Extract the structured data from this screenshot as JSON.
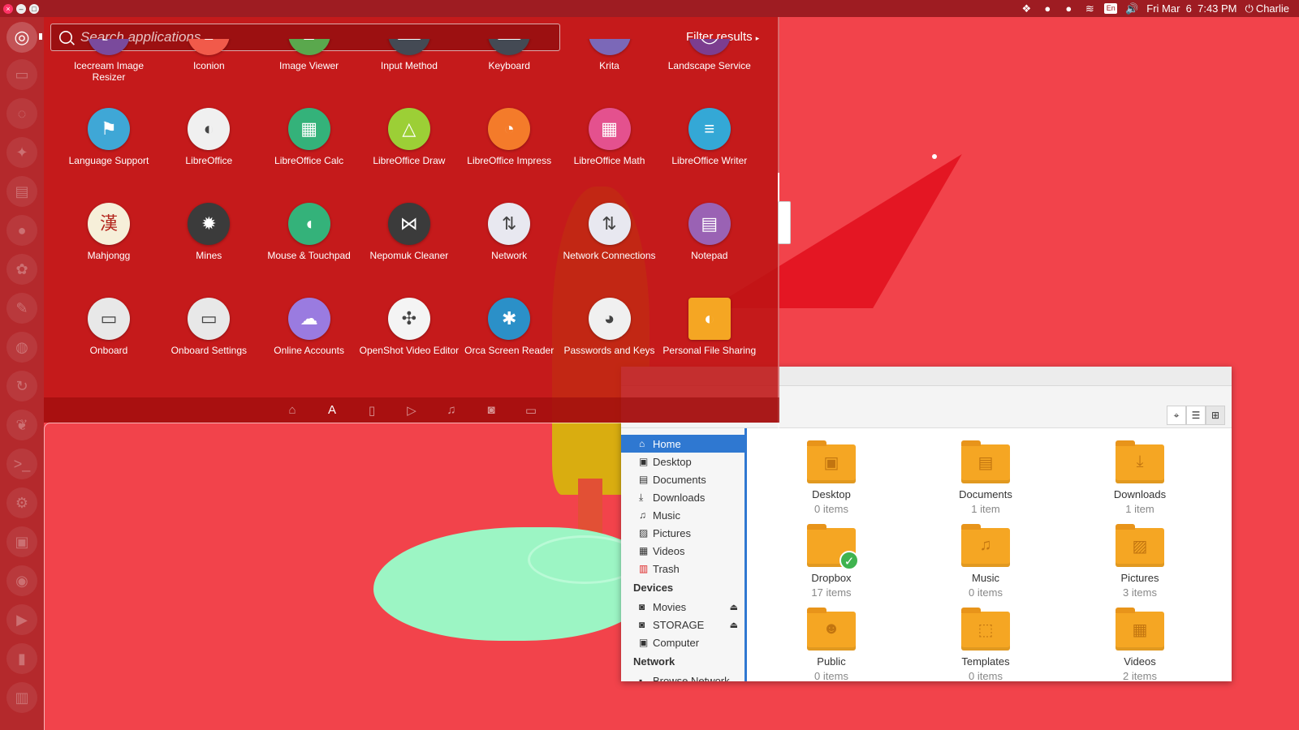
{
  "top_panel": {
    "clock": "Fri Mar  6  7:43 PM",
    "user": "Charlie",
    "keyboard": "En"
  },
  "dash": {
    "search_placeholder": "Search applications",
    "filter_label": "Filter results",
    "apps": [
      {
        "label": "Icecream Image Resizer",
        "icon": "image-resizer-icon",
        "color": "#7a4a9c"
      },
      {
        "label": "Iconion",
        "icon": "iconion-icon",
        "color": "#f15a4a"
      },
      {
        "label": "Image Viewer",
        "icon": "image-viewer-icon",
        "color": "#5aa84d"
      },
      {
        "label": "Input Method",
        "icon": "input-method-icon",
        "color": "#444a54"
      },
      {
        "label": "Keyboard",
        "icon": "keyboard-icon",
        "color": "#444a54"
      },
      {
        "label": "Krita",
        "icon": "krita-icon",
        "color": "#7b68b8"
      },
      {
        "label": "Landscape Service",
        "icon": "landscape-icon",
        "color": "#7c3d8f"
      },
      {
        "label": "Language Support",
        "icon": "language-support-icon",
        "color": "#3fa7d6"
      },
      {
        "label": "LibreOffice",
        "icon": "libreoffice-icon",
        "color": "#f0f0f0"
      },
      {
        "label": "LibreOffice Calc",
        "icon": "calc-icon",
        "color": "#34b27a"
      },
      {
        "label": "LibreOffice Draw",
        "icon": "draw-icon",
        "color": "#9ccf36"
      },
      {
        "label": "LibreOffice Impress",
        "icon": "impress-icon",
        "color": "#f47b2a"
      },
      {
        "label": "LibreOffice Math",
        "icon": "math-icon",
        "color": "#e4518e"
      },
      {
        "label": "LibreOffice Writer",
        "icon": "writer-icon",
        "color": "#34a8d6"
      },
      {
        "label": "Mahjongg",
        "icon": "mahjongg-icon",
        "color": "#f6efd9"
      },
      {
        "label": "Mines",
        "icon": "mines-icon",
        "color": "#3b3b3b"
      },
      {
        "label": "Mouse & Touchpad",
        "icon": "mouse-icon",
        "color": "#34b27a"
      },
      {
        "label": "Nepomuk Cleaner",
        "icon": "nepomuk-icon",
        "color": "#3b3b3b"
      },
      {
        "label": "Network",
        "icon": "network-icon",
        "color": "#e8e8f0"
      },
      {
        "label": "Network Connections",
        "icon": "network-connections-icon",
        "color": "#e8e8f0"
      },
      {
        "label": "Notepad",
        "icon": "notepad-icon",
        "color": "#9a62b4"
      },
      {
        "label": "Onboard",
        "icon": "onboard-icon",
        "color": "#e8e8e8"
      },
      {
        "label": "Onboard Settings",
        "icon": "onboard-settings-icon",
        "color": "#e8e8e8"
      },
      {
        "label": "Online Accounts",
        "icon": "online-accounts-icon",
        "color": "#9a7be0"
      },
      {
        "label": "OpenShot Video Editor",
        "icon": "openshot-icon",
        "color": "#f4f4f4"
      },
      {
        "label": "Orca Screen Reader",
        "icon": "orca-icon",
        "color": "#2b90c8"
      },
      {
        "label": "Passwords and Keys",
        "icon": "passwords-icon",
        "color": "#f0f0f0"
      },
      {
        "label": "Personal File Sharing",
        "icon": "file-sharing-icon",
        "color": "#f5a623"
      }
    ]
  },
  "file_manager": {
    "sidebar": {
      "places": [
        {
          "label": "Home",
          "icon": "home-icon"
        },
        {
          "label": "Desktop",
          "icon": "desktop-icon"
        },
        {
          "label": "Documents",
          "icon": "documents-icon"
        },
        {
          "label": "Downloads",
          "icon": "downloads-icon"
        },
        {
          "label": "Music",
          "icon": "music-icon"
        },
        {
          "label": "Pictures",
          "icon": "pictures-icon"
        },
        {
          "label": "Videos",
          "icon": "videos-icon"
        },
        {
          "label": "Trash",
          "icon": "trash-icon"
        }
      ],
      "devices_header": "Devices",
      "devices": [
        {
          "label": "Movies",
          "icon": "drive-icon"
        },
        {
          "label": "STORAGE",
          "icon": "drive-icon"
        },
        {
          "label": "Computer",
          "icon": "computer-icon"
        }
      ],
      "network_header": "Network",
      "network": [
        {
          "label": "Browse Network",
          "icon": "network-icon"
        }
      ]
    },
    "folders": [
      {
        "name": "Desktop",
        "count": "0 items",
        "icon": "desktop-folder-icon"
      },
      {
        "name": "Documents",
        "count": "1 item",
        "icon": "documents-folder-icon"
      },
      {
        "name": "Downloads",
        "count": "1 item",
        "icon": "downloads-folder-icon"
      },
      {
        "name": "Dropbox",
        "count": "17 items",
        "icon": "dropbox-folder-icon"
      },
      {
        "name": "Music",
        "count": "0 items",
        "icon": "music-folder-icon"
      },
      {
        "name": "Pictures",
        "count": "3 items",
        "icon": "pictures-folder-icon"
      },
      {
        "name": "Public",
        "count": "0 items",
        "icon": "public-folder-icon"
      },
      {
        "name": "Templates",
        "count": "0 items",
        "icon": "templates-folder-icon"
      },
      {
        "name": "Videos",
        "count": "2 items",
        "icon": "videos-folder-icon"
      }
    ]
  }
}
